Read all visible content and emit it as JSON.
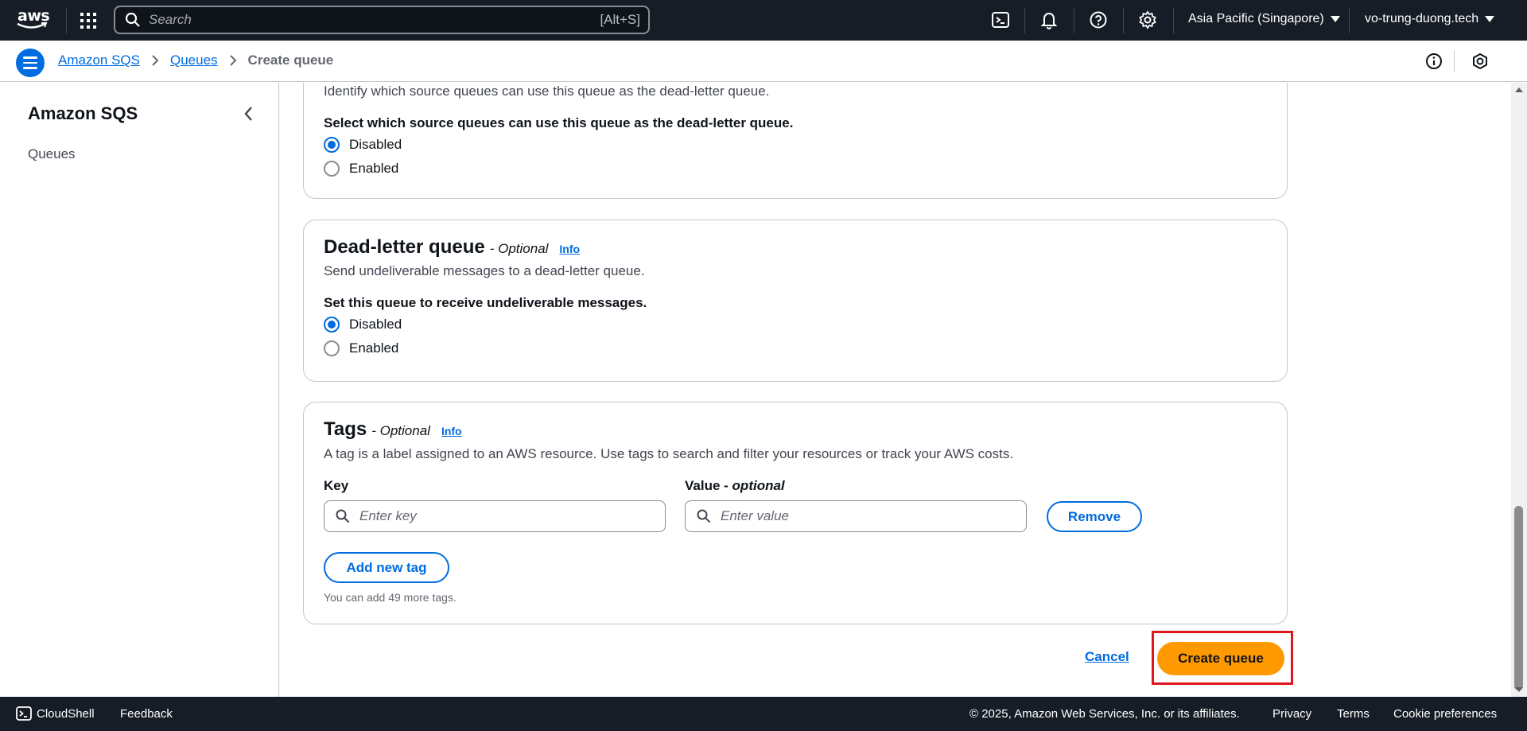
{
  "topnav": {
    "logo_text": "aws",
    "search_placeholder": "Search",
    "search_shortcut": "[Alt+S]",
    "region": "Asia Pacific (Singapore)",
    "account": "vo-trung-duong.tech",
    "icons": [
      "grid-icon",
      "search-icon",
      "cloudshell-icon",
      "bell-icon",
      "help-icon",
      "gear-icon"
    ]
  },
  "breadcrumb": {
    "items": [
      "Amazon SQS",
      "Queues"
    ],
    "current": "Create queue"
  },
  "sidebar": {
    "title": "Amazon SQS",
    "items": [
      "Queues"
    ]
  },
  "redrive_panel": {
    "description": "Identify which source queues can use this queue as the dead-letter queue.",
    "label": "Select which source queues can use this queue as the dead-letter queue.",
    "options": [
      {
        "label": "Disabled",
        "selected": true
      },
      {
        "label": "Enabled",
        "selected": false
      }
    ]
  },
  "dlq_panel": {
    "title": "Dead-letter queue",
    "optional": "- Optional",
    "info": "Info",
    "description": "Send undeliverable messages to a dead-letter queue.",
    "label": "Set this queue to receive undeliverable messages.",
    "options": [
      {
        "label": "Disabled",
        "selected": true
      },
      {
        "label": "Enabled",
        "selected": false
      }
    ]
  },
  "tags_panel": {
    "title": "Tags",
    "optional": "- Optional",
    "info": "Info",
    "description": "A tag is a label assigned to an AWS resource. Use tags to search and filter your resources or track your AWS costs.",
    "key_label": "Key",
    "value_label": "Value -",
    "value_label_optional": "optional",
    "key_placeholder": "Enter key",
    "value_placeholder": "Enter value",
    "remove_label": "Remove",
    "add_label": "Add new tag",
    "hint": "You can add 49 more tags."
  },
  "actions": {
    "cancel": "Cancel",
    "create": "Create queue"
  },
  "footer": {
    "cloudshell": "CloudShell",
    "feedback": "Feedback",
    "copyright": "© 2025, Amazon Web Services, Inc. or its affiliates.",
    "privacy": "Privacy",
    "terms": "Terms",
    "cookies": "Cookie preferences"
  },
  "colors": {
    "nav_bg": "#161d26",
    "link": "#006ce0",
    "primary": "#ff9900",
    "highlight": "#e0161f"
  }
}
